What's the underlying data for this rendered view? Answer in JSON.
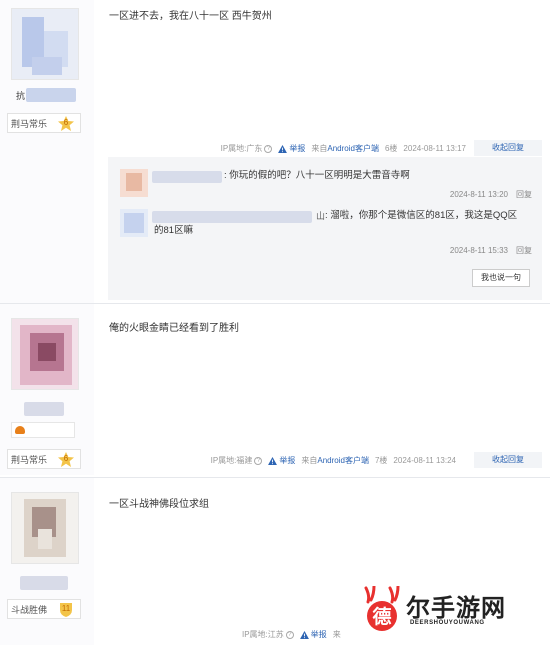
{
  "posts": [
    {
      "username_prefix": "抗",
      "badge_title": "荆马常乐",
      "badge_level": "6",
      "content": "一区进不去，我在八十一区 西牛贺州",
      "meta": {
        "ip": "IP属地:广东",
        "report": "举报",
        "source_prefix": "来自",
        "source_link": "Android客户端",
        "floor": "6楼",
        "time": "2024-08-11 13:17"
      },
      "collapse_label": "收起回复"
    },
    {
      "badge_title": "荆马常乐",
      "badge_level": "6",
      "content": "俺的火眼金睛已经看到了胜利",
      "meta": {
        "ip": "IP属地:福建",
        "report": "举报",
        "source_prefix": "来自",
        "source_link": "Android客户端",
        "floor": "7楼",
        "time": "2024-08-11 13:24"
      },
      "collapse_label": "收起回复"
    },
    {
      "badge_title": "斗战胜佛",
      "badge_level": "11",
      "content": "一区斗战神佛段位求组",
      "meta": {
        "ip": "IP属地:江苏",
        "report": "举报",
        "source_prefix": "来"
      }
    }
  ],
  "replies": [
    {
      "text_line1": ": 你玩的假的吧？八十一区明明是大雷音寺啊",
      "time": "2024-8-11 13:20",
      "reply_label": "回复"
    },
    {
      "name_suffix": "山",
      "text_line1": ": 溜啦，你那个是微信区的81区，我这是QQ区",
      "text_line2": "的81区嘛",
      "time": "2024-8-11 15:33",
      "reply_label": "回复"
    }
  ],
  "say_button": "我也说一句",
  "watermark": {
    "logo_char": "德",
    "text": "尔手游网",
    "subtext": "DEERSHOUYOUWANG"
  },
  "colors": {
    "link": "#2d64b3",
    "meta_text": "#999999",
    "badge_level": "#f3c449",
    "watermark_accent": "#e8312f"
  }
}
